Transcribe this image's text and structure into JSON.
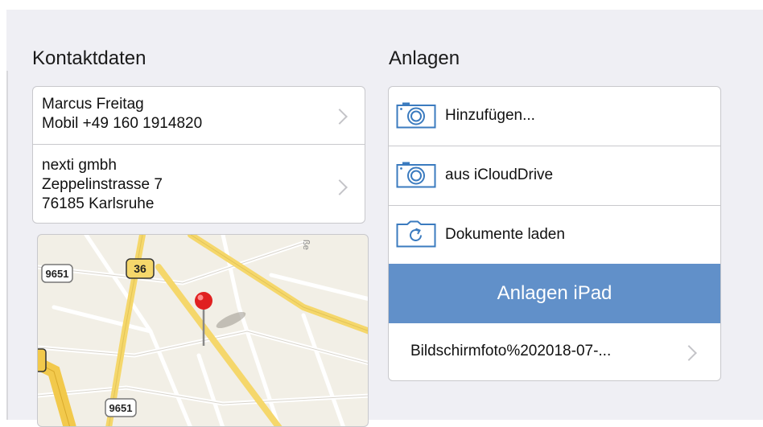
{
  "contact": {
    "title": "Kontaktdaten",
    "person": {
      "name": "Marcus Freitag",
      "phone": "Mobil +49 160 1914820"
    },
    "company": {
      "name": "nexti gmbh",
      "street": "Zeppelinstrasse 7",
      "city": "76185 Karlsruhe"
    },
    "map": {
      "road_labels": [
        "9651",
        "36",
        "9651"
      ],
      "street_fragment": "ße"
    }
  },
  "attachments": {
    "title": "Anlagen",
    "actions": [
      {
        "label": "Hinzufügen...",
        "icon": "camera-icon"
      },
      {
        "label": "aus iCloudDrive",
        "icon": "camera-icon"
      },
      {
        "label": "Dokumente laden",
        "icon": "camera-rotate-icon"
      }
    ],
    "group_header": "Anlagen iPad",
    "files": [
      {
        "name": "Bildschirmfoto%202018-07-..."
      }
    ]
  },
  "colors": {
    "accent": "#6190c9",
    "icon_blue": "#3b7bbf",
    "pin_red": "#e02020",
    "road_yellow": "#f5d76b"
  }
}
